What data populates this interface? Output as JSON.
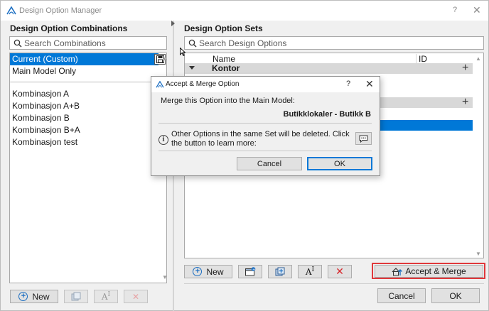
{
  "window": {
    "title": "Design Option Manager",
    "help_label": "?",
    "close_label": "✕"
  },
  "left": {
    "section_title": "Design Option Combinations",
    "search": {
      "placeholder": "Search Combinations",
      "value": ""
    },
    "top_items": [
      {
        "label": "Current (Custom)",
        "selected": true
      },
      {
        "label": "Main Model Only",
        "selected": false
      }
    ],
    "items": [
      {
        "label": "Kombinasjon A"
      },
      {
        "label": "Kombinasjon A+B"
      },
      {
        "label": "Kombinasjon B"
      },
      {
        "label": "Kombinasjon B+A"
      },
      {
        "label": "Kombinasjon test"
      }
    ],
    "toolbar": {
      "new_label": "New"
    }
  },
  "right": {
    "section_title": "Design Option Sets",
    "search": {
      "placeholder": "Search Design Options",
      "value": ""
    },
    "columns": {
      "name": "Name",
      "id": "ID"
    },
    "sets": [
      {
        "name": "Kontor",
        "expanded": true
      }
    ],
    "toolbar": {
      "new_label": "New"
    },
    "accept_merge_label": "Accept & Merge",
    "cancel_label": "Cancel",
    "ok_label": "OK"
  },
  "dialog": {
    "title": "Accept & Merge Option",
    "help_label": "?",
    "close_label": "✕",
    "message": "Merge this Option into the Main Model:",
    "option_name": "Butikklokaler - Butikk B",
    "info_text": "Other Options in the same Set will be deleted. Click the button to learn more:",
    "cancel_label": "Cancel",
    "ok_label": "OK"
  },
  "icons": {
    "app_logo": "archicad-logo-icon",
    "search": "search-icon",
    "save": "save-icon",
    "plus": "plus-circle-icon",
    "info": "info-icon",
    "chat": "speech-bubble-icon"
  },
  "colors": {
    "selection": "#0078d7",
    "highlight": "#e0383b",
    "delete": "#d7262b"
  }
}
